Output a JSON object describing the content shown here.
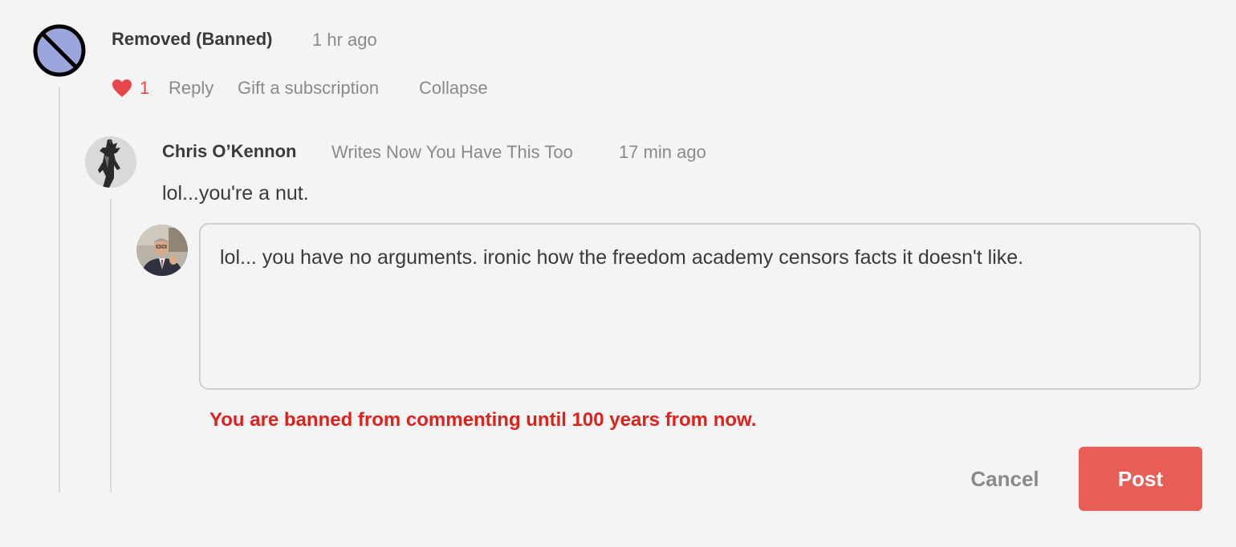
{
  "comment": {
    "author": "Removed (Banned)",
    "time": "1 hr ago",
    "avatar_icon": "banned-icon",
    "likes": "1",
    "actions": {
      "reply": "Reply",
      "gift": "Gift a subscription",
      "collapse": "Collapse"
    }
  },
  "reply": {
    "author": "Chris O’Kennon",
    "byline": "Writes Now You Have This Too",
    "time": "17 min ago",
    "body": "lol...you're a nut."
  },
  "composer": {
    "value": "lol... you have no arguments. ironic how the freedom academy censors facts it doesn't like.",
    "error": "You are banned from commenting until 100 years from now.",
    "cancel_label": "Cancel",
    "post_label": "Post"
  },
  "colors": {
    "accent": "#e85d56",
    "error": "#e0201b",
    "heart": "#e8474a"
  }
}
